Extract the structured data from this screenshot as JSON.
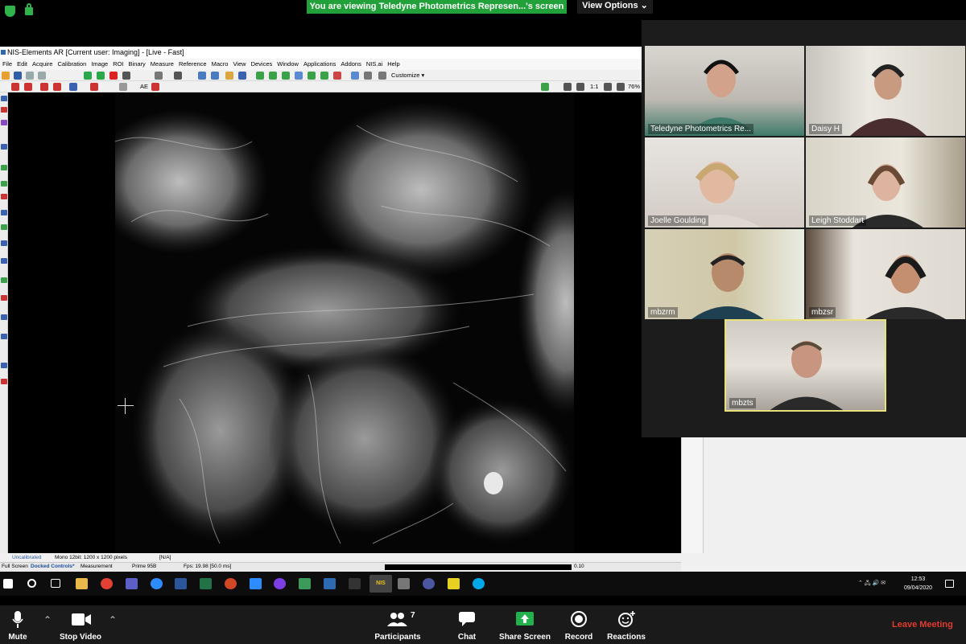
{
  "top_bar": {
    "banner_text": "You are viewing Teledyne Photometrics Represen...'s screen",
    "view_options_label": "View Options"
  },
  "nis_app": {
    "title": "NIS-Elements AR [Current user: Imaging] - [Live - Fast]",
    "menu": [
      "File",
      "Edit",
      "Acquire",
      "Calibration",
      "Image",
      "ROI",
      "Binary",
      "Measure",
      "Reference",
      "Macro",
      "View",
      "Devices",
      "Window",
      "Applications",
      "Addons",
      "NIS.ai",
      "Help"
    ],
    "customize_label": "Customize",
    "zoom_ratio": "1:1",
    "zoom_percent": "76%",
    "status": {
      "calibration": "Uncalibrated",
      "image_info": "Mono 12bit: 1200 x 1200 pixels",
      "value": "[N/A]"
    },
    "tabs": [
      "Full Screen",
      "Docked Controls*",
      "Measurement"
    ],
    "camera": "Prime 95B",
    "fps": "Fps: 19.98 [50.0 ms]",
    "progress_value": "0.10"
  },
  "taskbar": {
    "time": "12:53",
    "date": "09/04/2020",
    "nis_label": "NIS"
  },
  "participants": [
    {
      "name": "Teledyne Photometrics Re..."
    },
    {
      "name": "Daisy H"
    },
    {
      "name": "Joelle Goulding"
    },
    {
      "name": "Leigh Stoddart"
    },
    {
      "name": "mbzrm"
    },
    {
      "name": "mbzsr"
    },
    {
      "name": "mbzts"
    }
  ],
  "controls": {
    "mute": "Mute",
    "stop_video": "Stop Video",
    "participants": "Participants",
    "participants_count": "7",
    "chat": "Chat",
    "share_screen": "Share Screen",
    "record": "Record",
    "reactions": "Reactions",
    "leave": "Leave Meeting"
  },
  "colors": {
    "banner_green": "#22a13a",
    "share_green": "#22b14c",
    "leave_red": "#e23a2e",
    "active_speaker_border": "#e8e07a"
  }
}
